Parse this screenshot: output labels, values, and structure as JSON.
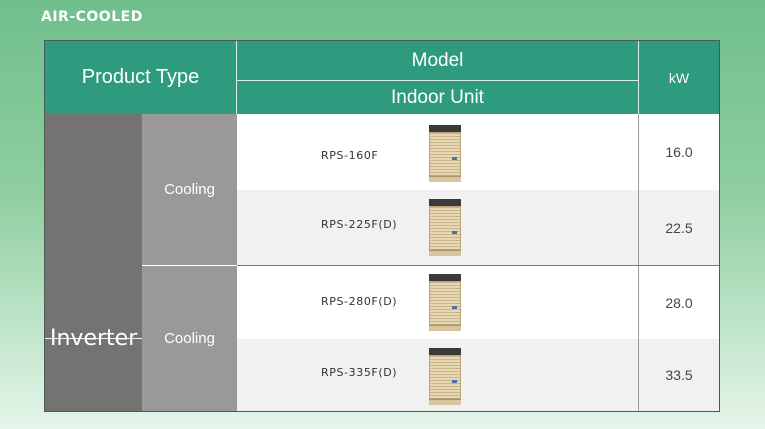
{
  "section_title": "AIR-COOLED",
  "header": {
    "product_type": "Product Type",
    "model": "Model",
    "indoor_unit": "Indoor Unit",
    "kw": "kW"
  },
  "group": {
    "label": "Inverter",
    "modes": [
      "Cooling",
      "Cooling"
    ]
  },
  "rows": [
    {
      "model": "RPS-160F",
      "kw": "16.0"
    },
    {
      "model": "RPS-225F(D)",
      "kw": "22.5"
    },
    {
      "model": "RPS-280F(D)",
      "kw": "28.0"
    },
    {
      "model": "RPS-335F(D)",
      "kw": "33.5"
    }
  ],
  "colors": {
    "header": "#2e9a7e",
    "inverter": "#757272",
    "mode": "#9a9898"
  }
}
